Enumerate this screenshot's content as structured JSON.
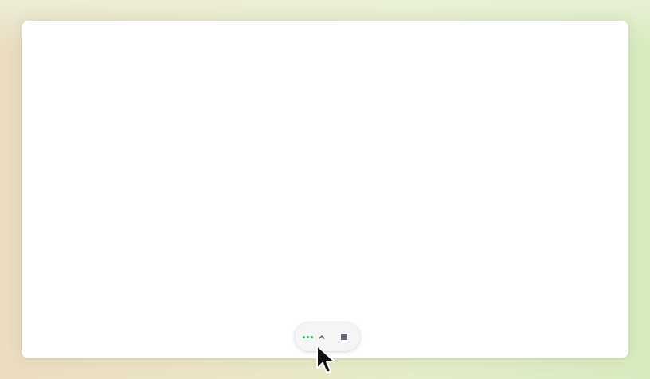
{
  "window": {
    "background": "#ffffff"
  },
  "recording_bar": {
    "status_icon": "recording-activity-dots-icon",
    "status_color": "#3fc46a",
    "expand_icon": "chevron-up-icon",
    "stop_icon": "stop-square-icon",
    "stop_color": "#606a7c"
  },
  "cursor": {
    "icon": "arrow-pointer-icon"
  }
}
